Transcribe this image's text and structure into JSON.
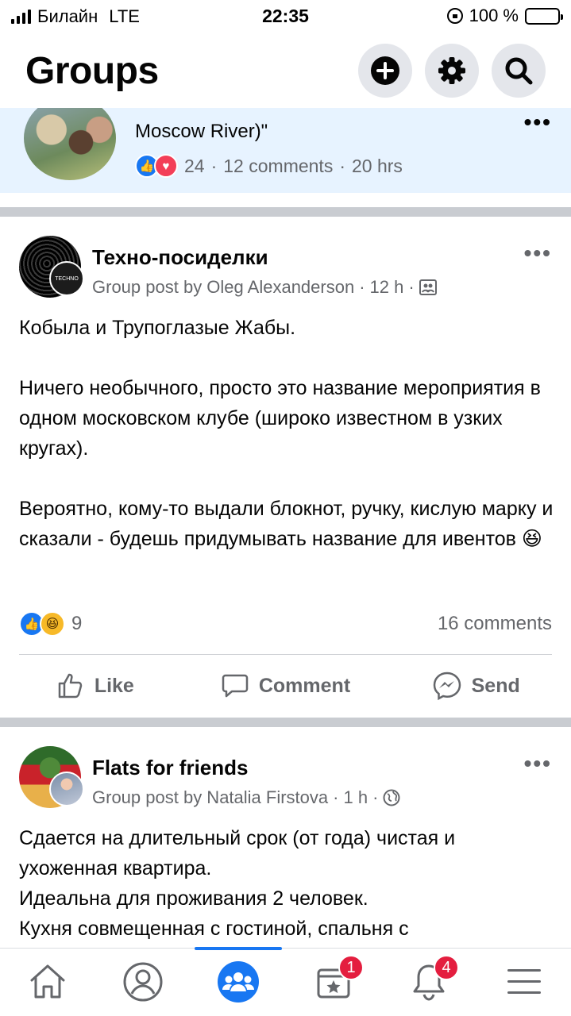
{
  "status_bar": {
    "carrier": "Билайн",
    "network": "LTE",
    "time": "22:35",
    "battery": "100 %"
  },
  "header": {
    "title": "Groups",
    "buttons": [
      "plus-icon",
      "gear-icon",
      "search-icon"
    ]
  },
  "feed": {
    "top_card": {
      "text": "Moscow River)\"",
      "reaction_count": "24",
      "comments": "12 comments",
      "time": "20 hrs",
      "reactions": [
        "like",
        "love"
      ]
    },
    "posts": [
      {
        "group": "Техно-посиделки",
        "meta_prefix": "Group post by Oleg Alexanderson",
        "time": "12 h",
        "privacy_icon": "group-members-icon",
        "avatar_sub_text": "TECHNO",
        "paragraphs": [
          "Кобыла и Трупоглазые Жабы.",
          "Ничего необычного, просто это название мероприятия в одном московском клубе (широко известном в узких кругах).",
          "Вероятно, кому-то выдали блокнот, ручку, кислую марку и сказали - будешь придумывать название для ивентов 😆"
        ],
        "reaction_count": "9",
        "reactions": [
          "like",
          "haha"
        ],
        "comments": "16 comments",
        "actions": {
          "like": "Like",
          "comment": "Comment",
          "send": "Send"
        }
      },
      {
        "group": "Flats for friends",
        "meta_prefix": "Group post by Natalia Firstova",
        "time": "1 h",
        "privacy_icon": "globe-icon",
        "paragraphs": [
          "Сдается на длительный срок (от года) чистая и ухоженная квартира.",
          "Идеальна для проживания 2 человек.",
          "Кухня совмещенная с гостиной, спальня с"
        ]
      }
    ]
  },
  "tabbar": {
    "tabs": [
      {
        "name": "home",
        "icon": "home-icon"
      },
      {
        "name": "profile",
        "icon": "profile-icon"
      },
      {
        "name": "groups",
        "icon": "groups-icon",
        "active": true
      },
      {
        "name": "pages",
        "icon": "pages-icon",
        "badge": "1"
      },
      {
        "name": "notifications",
        "icon": "bell-icon",
        "badge": "4"
      },
      {
        "name": "menu",
        "icon": "menu-icon"
      }
    ]
  },
  "colors": {
    "accent": "#1877f2",
    "highlight_bg": "#e7f3ff",
    "badge": "#e41e3f",
    "secondary_text": "#65676b"
  }
}
